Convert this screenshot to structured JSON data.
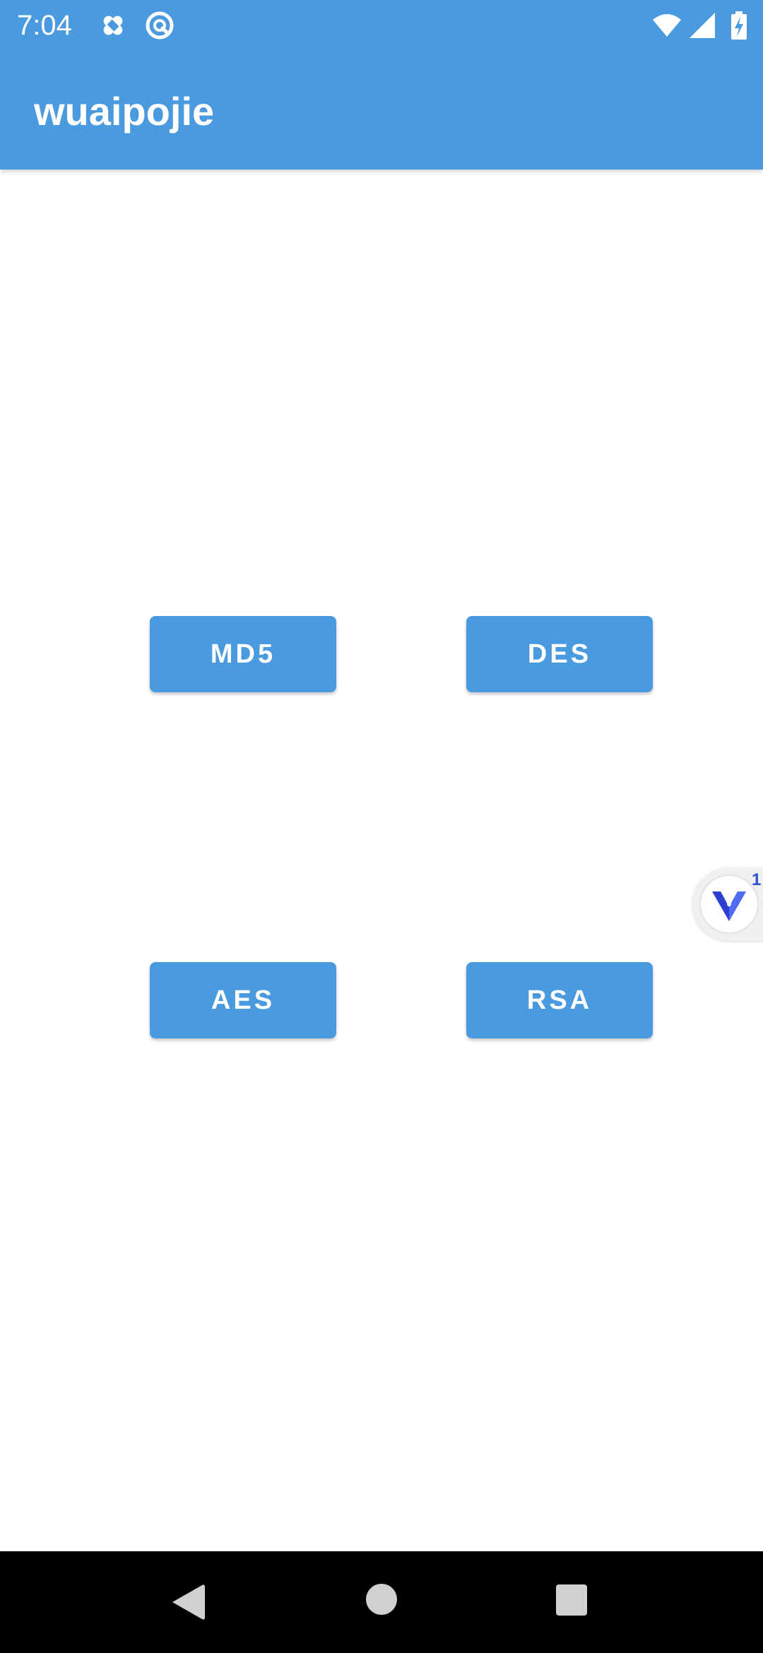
{
  "status_bar": {
    "time": "7:04",
    "left_icons": [
      "bandage-icon",
      "circle-slash-icon"
    ],
    "right_icons": [
      "wifi-icon",
      "cellular-signal-icon",
      "battery-charging-icon"
    ]
  },
  "app_bar": {
    "title": "wuaipojie",
    "color": "#4a9ae0"
  },
  "buttons": {
    "md5": "MD5",
    "des": "DES",
    "aes": "AES",
    "rsa": "RSA",
    "color": "#4a9ae0"
  },
  "floating_widget": {
    "icon": "v-logo-icon",
    "badge": "1"
  },
  "nav_bar": {
    "icons": [
      "back-icon",
      "home-icon",
      "recents-icon"
    ]
  }
}
